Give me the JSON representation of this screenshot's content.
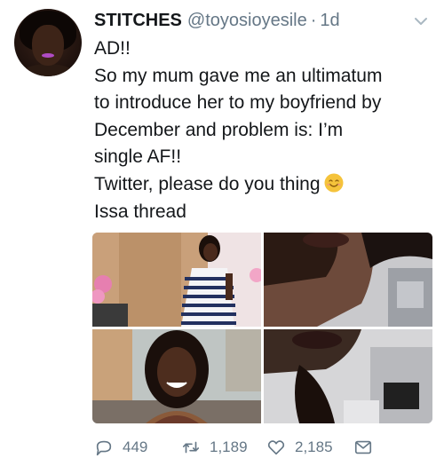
{
  "tweet": {
    "display_name": "STITCHES",
    "handle": "@toyosioyesile",
    "separator": "·",
    "time": "1d",
    "text_lines": [
      "AD!!",
      "So my mum gave me an ultimatum",
      "to introduce her to my boyfriend by",
      "December and problem is: I’m",
      "single AF!!",
      "Twitter, please do you thing",
      "Issa thread"
    ],
    "emoji": "smiling-face-emoji"
  },
  "media": {
    "count": 4,
    "photos": [
      {
        "description_icon": "photo-woman-striped-dress"
      },
      {
        "description_icon": "photo-selfie-closeup"
      },
      {
        "description_icon": "photo-woman-smiling"
      },
      {
        "description_icon": "photo-selfie-car"
      }
    ]
  },
  "actions": {
    "replies": "449",
    "retweets": "1,189",
    "likes": "2,185",
    "icons": [
      "reply-icon",
      "retweet-icon",
      "like-icon",
      "direct-message-icon"
    ]
  },
  "colors": {
    "text": "#14171a",
    "secondary": "#657786",
    "emoji": "#f5c33b"
  }
}
